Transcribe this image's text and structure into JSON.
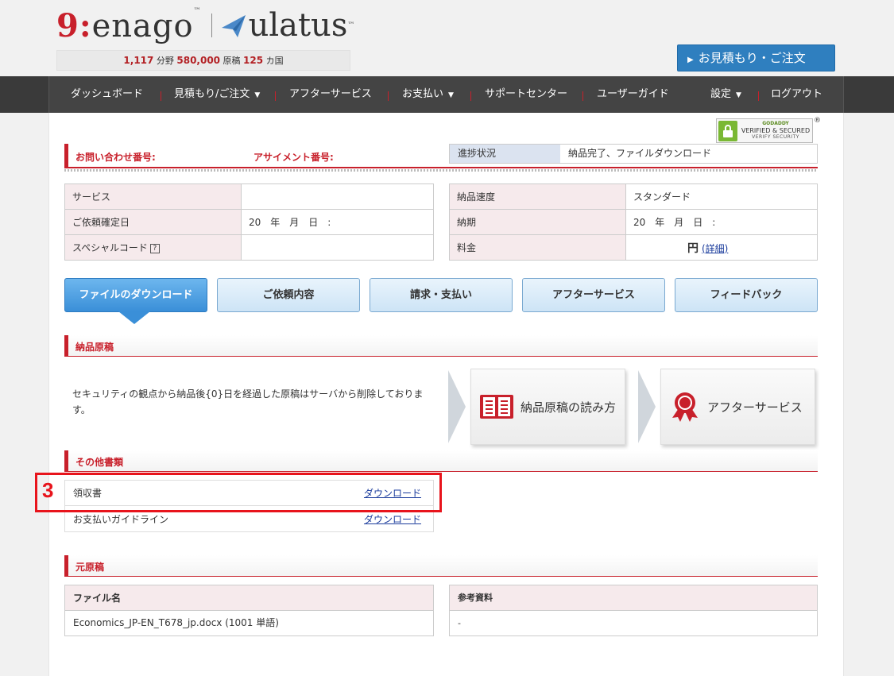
{
  "header": {
    "logo_enago": "enago",
    "logo_ulatus": "ulatus",
    "stats": {
      "fields_count": "1,117",
      "fields_label": "分野",
      "manuscripts_count": "580,000",
      "manuscripts_label": "原稿",
      "countries_count": "125",
      "countries_label": "カ国"
    },
    "quote_button": "お見積もり・ご注文"
  },
  "nav": {
    "items": [
      "ダッシュボード",
      "見積もり/ご注文",
      "アフターサービス",
      "お支払い",
      "サポートセンター",
      "ユーザーガイド",
      "設定",
      "ログアウト"
    ]
  },
  "badge": {
    "line1": "GODADDY",
    "line2": "VERIFIED & SECURED",
    "line3": "VERIFY SECURITY",
    "reg": "®"
  },
  "status": {
    "inquiry_label": "お問い合わせ番号:",
    "assignment_label": "アサイメント番号:",
    "progress_label": "進捗状況",
    "progress_value": "納品完了、ファイルダウンロード"
  },
  "info_left": [
    {
      "label": "サービス",
      "value": ""
    },
    {
      "label": "ご依頼確定日",
      "value": "20　年　月　日　:"
    },
    {
      "label": "スペシャルコード",
      "help": "?",
      "value": ""
    }
  ],
  "info_right": [
    {
      "label": "納品速度",
      "value": "スタンダード"
    },
    {
      "label": "納期",
      "value": "20　年　月　日　:"
    },
    {
      "label": "料金",
      "currency": "円",
      "link": "(詳細)"
    }
  ],
  "tabs": [
    "ファイルのダウンロード",
    "ご依頼内容",
    "請求・支払い",
    "アフターサービス",
    "フィードバック"
  ],
  "delivered": {
    "title": "納品原稿",
    "note": "セキュリティの観点から納品後{0}日を経過した原稿はサーバから削除しております。",
    "guide_button": "納品原稿の読み方",
    "after_button": "アフターサービス"
  },
  "other_docs": {
    "title": "その他書類",
    "rows": [
      {
        "name": "領収書",
        "link": "ダウンロード"
      },
      {
        "name": "お支払いガイドライン",
        "link": "ダウンロード"
      }
    ],
    "highlight_number": "3"
  },
  "original": {
    "title": "元原稿",
    "file_header": "ファイル名",
    "file_value": "Economics_JP-EN_T678_jp.docx (1001 単語)",
    "ref_header": "参考資料",
    "ref_value": "-"
  },
  "colors": {
    "brand_red": "#c8202b",
    "accent_blue": "#2f7fbf",
    "highlight_red": "#e8141c"
  }
}
